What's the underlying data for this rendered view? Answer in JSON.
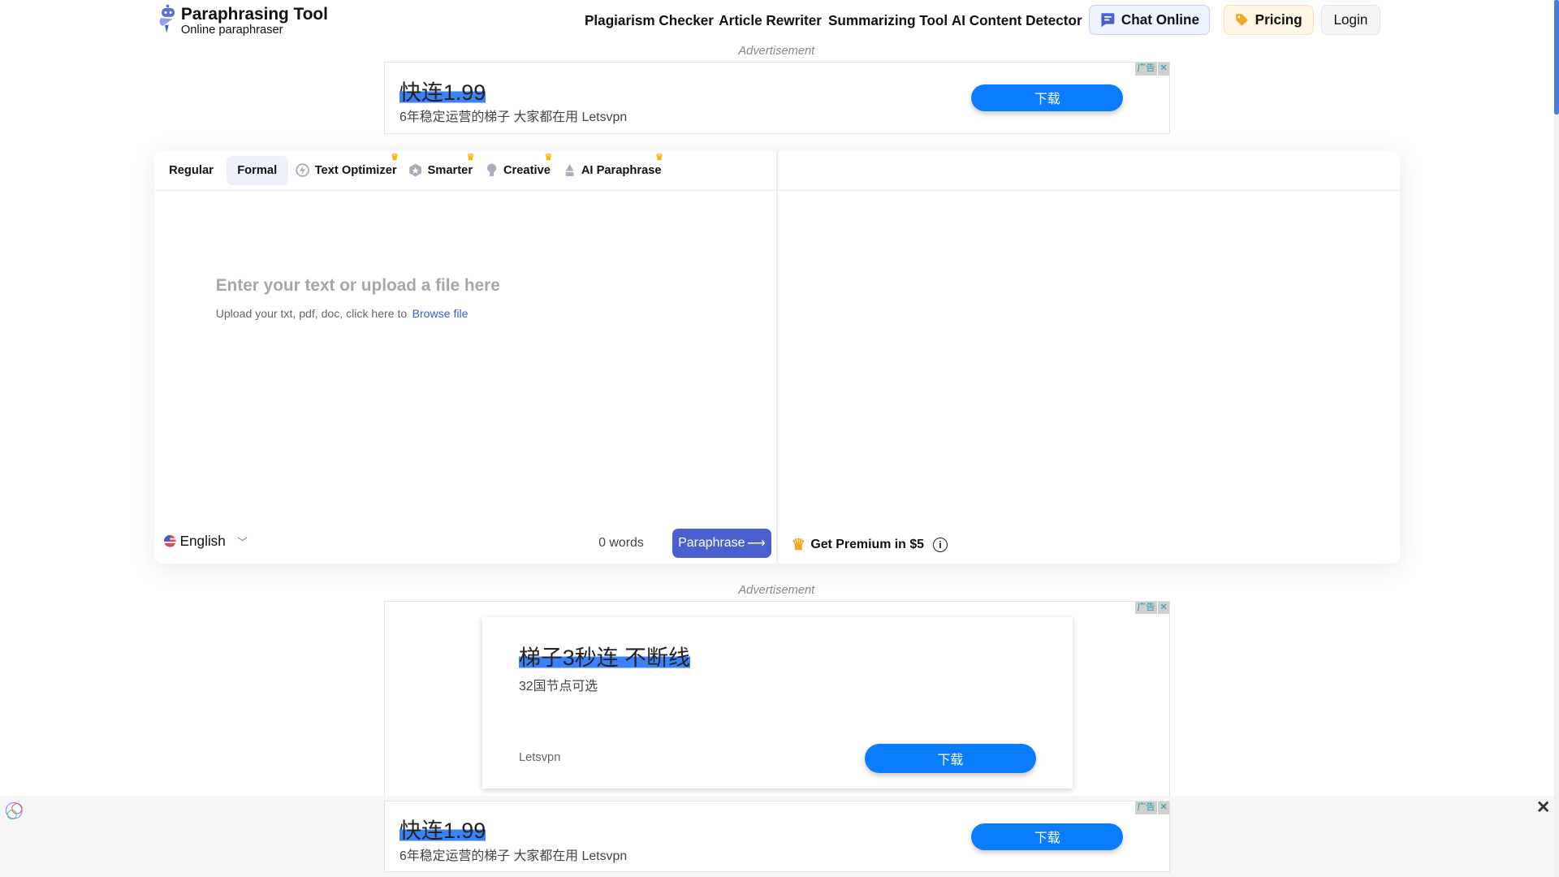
{
  "header": {
    "logo_title": "Paraphrasing Tool",
    "logo_subtitle": "Online paraphraser",
    "nav": [
      "Plagiarism Checker",
      "Article Rewriter",
      "Summarizing Tool",
      "AI Content Detector"
    ],
    "chat_label": "Chat Online",
    "pricing_label": "Pricing",
    "login_label": "Login"
  },
  "ads": {
    "label": "Advertisement",
    "badge": "广告",
    "close": "✕",
    "top": {
      "title": "快连1.99",
      "subtitle": "6年稳定运营的梯子 大家都在用 Letsvpn",
      "button": "下载"
    },
    "middle": {
      "title": "梯子3秒连 不断线",
      "subtitle": "32国节点可选",
      "brand": "Letsvpn",
      "button": "下载"
    },
    "sticky": {
      "title": "快连1.99",
      "subtitle": "6年稳定运营的梯子 大家都在用 Letsvpn",
      "button": "下载",
      "close": "✕"
    }
  },
  "editor": {
    "tabs": [
      {
        "label": "Regular",
        "premium": false
      },
      {
        "label": "Formal",
        "premium": false,
        "active": true
      },
      {
        "label": "Text Optimizer",
        "premium": true,
        "icon": "lightning-icon"
      },
      {
        "label": "Smarter",
        "premium": true,
        "icon": "hexagon-star-icon"
      },
      {
        "label": "Creative",
        "premium": true,
        "icon": "lightbulb-icon"
      },
      {
        "label": "AI Paraphrase",
        "premium": true,
        "icon": "pen-nib-icon"
      }
    ],
    "placeholder": "Enter your text or upload a file here",
    "upload_hint": "Upload your txt, pdf, doc, click here to",
    "browse_link": "Browse file",
    "language": "English",
    "word_count": "0 words",
    "paraphrase_button": "Paraphrase",
    "premium_text": "Get Premium in $5"
  },
  "colors": {
    "primary": "#4a5fd0",
    "ad_blue": "#0a7cff",
    "crown": "#f5b800"
  }
}
